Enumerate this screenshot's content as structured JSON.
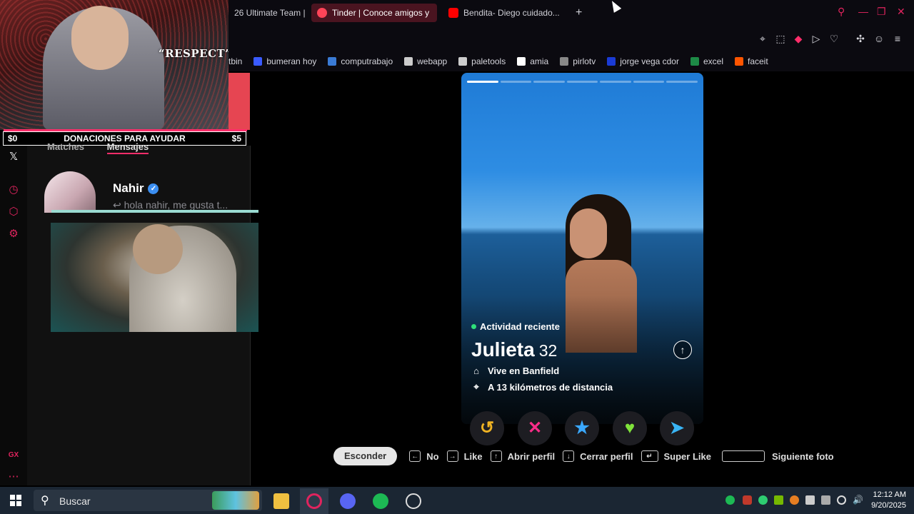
{
  "browser": {
    "tabs": [
      {
        "label": "26 Ultimate Team |",
        "active": false
      },
      {
        "label": "Tinder | Conoce amigos y",
        "active": true
      },
      {
        "label": "Bendita- Diego cuidado...",
        "active": false
      }
    ],
    "new_tab_label": "+",
    "bookmarks": [
      {
        "label": "tbin",
        "color": "#f0a020"
      },
      {
        "label": "bumeran hoy",
        "color": "#3a5bff"
      },
      {
        "label": "computrabajo",
        "color": "#3a7bd5"
      },
      {
        "label": "webapp",
        "color": "#cccccc"
      },
      {
        "label": "paletools",
        "color": "#cccccc"
      },
      {
        "label": "amia",
        "color": "#ffffff"
      },
      {
        "label": "pirlotv",
        "color": "#888888"
      },
      {
        "label": "jorge vega cdor",
        "color": "#1a3bd5"
      },
      {
        "label": "excel",
        "color": "#1d8a46"
      },
      {
        "label": "faceit",
        "color": "#ff5500"
      }
    ]
  },
  "stream": {
    "respect_text": "“RESPECT”",
    "donation_left": "$0",
    "donation_text": "DONACIONES PARA AYUDAR",
    "donation_right": "$5"
  },
  "panel": {
    "tabs": {
      "matches": "Matches",
      "messages": "Mensajes"
    },
    "message": {
      "name": "Nahir",
      "verified_icon": "✓",
      "preview": "↩ hola nahir, me gusta t..."
    }
  },
  "profile": {
    "activity": "Actividad reciente",
    "name": "Julieta",
    "age": "32",
    "lives": "Vive en Banfield",
    "distance": "A 13 kilómetros de distancia",
    "photo_segments": 7,
    "active_segment": 1
  },
  "actions": [
    {
      "name": "rewind",
      "glyph": "↺",
      "color": "#f0b323"
    },
    {
      "name": "nope",
      "glyph": "✕",
      "color": "#ff2d8a"
    },
    {
      "name": "super-like",
      "glyph": "★",
      "color": "#3aa8ff"
    },
    {
      "name": "like",
      "glyph": "♥",
      "color": "#7fe33a"
    },
    {
      "name": "boost",
      "glyph": "➤",
      "color": "#39b4f4"
    }
  ],
  "shortcuts": {
    "hide": "Esconder",
    "no_key": "←",
    "no": "No",
    "like_key": "→",
    "like": "Like",
    "open_key": "↑",
    "open": "Abrir perfil",
    "close_key": "↓",
    "close": "Cerrar perfil",
    "super_key": "↵",
    "super": "Super Like",
    "next": "Siguiente foto"
  },
  "taskbar": {
    "search_label": "Buscar",
    "time": "12:12 AM",
    "date": "9/20/2025"
  },
  "colors": {
    "accent": "#e0245e",
    "tinder_red": "#ff2d6a"
  }
}
